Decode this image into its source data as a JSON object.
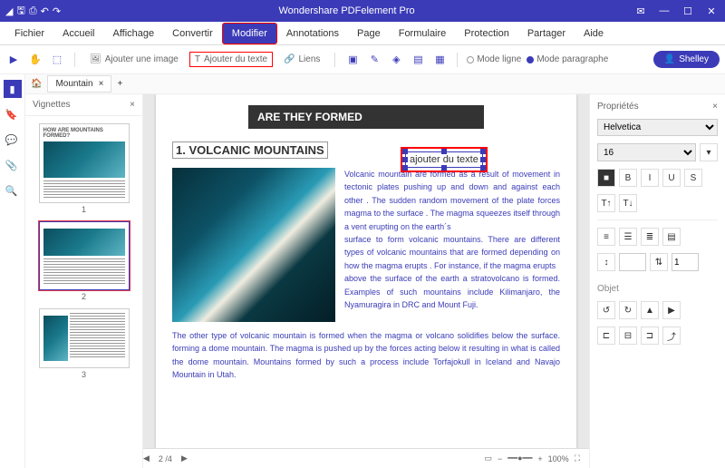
{
  "title": "Wondershare PDFelement Pro",
  "menu": [
    "Fichier",
    "Accueil",
    "Affichage",
    "Convertir",
    "Modifier",
    "Annotations",
    "Page",
    "Formulaire",
    "Protection",
    "Partager",
    "Aide"
  ],
  "menu_active": 4,
  "toolbar": {
    "add_image": "Ajouter une image",
    "add_text": "Ajouter du texte",
    "links": "Liens",
    "mode_line": "Mode ligne",
    "mode_para": "Mode paragraphe",
    "user": "Shelley"
  },
  "tab": {
    "name": "Mountain"
  },
  "thumbs": {
    "title": "Vignettes",
    "nums": [
      "1",
      "2",
      "3"
    ]
  },
  "doc": {
    "banner": "ARE THEY FORMED",
    "heading": "1. VOLCANIC MOUNTAINS",
    "textbox": "ajouter du texte",
    "para1": "Volcanic mountain are formed as a result of movement in tectonic plates pushing up and down and against each other . The sudden random movement  of the plate forces magma  to the surface . The magma squeezes itself through a vent erupting on the earth´s",
    "para2": "surface to form volcanic mountains. There are different types of volcanic mountains that are formed depending  on how the magma erupts . For instance, if the magma erupts",
    "para3": "above the surface of the earth a stratovolcano is formed. Examples of such mountains include Kilimanjaro, the Nyamuragira in DRC and Mount Fuji.",
    "para4": "The other type of volcanic mountain is formed when the magma or volcano solidifies below the surface. forming a dome mountain. The magma is pushed up by the forces acting below it resulting in what is called the dome mountain. Mountains formed by such a process include Torfajokull in Iceland and Navajo Mountain in Utah."
  },
  "props": {
    "title": "Propriétés",
    "font": "Helvetica",
    "size": "16",
    "object": "Objet",
    "line_h": "1"
  },
  "status": {
    "page": "2 /4",
    "zoom": "100%"
  }
}
